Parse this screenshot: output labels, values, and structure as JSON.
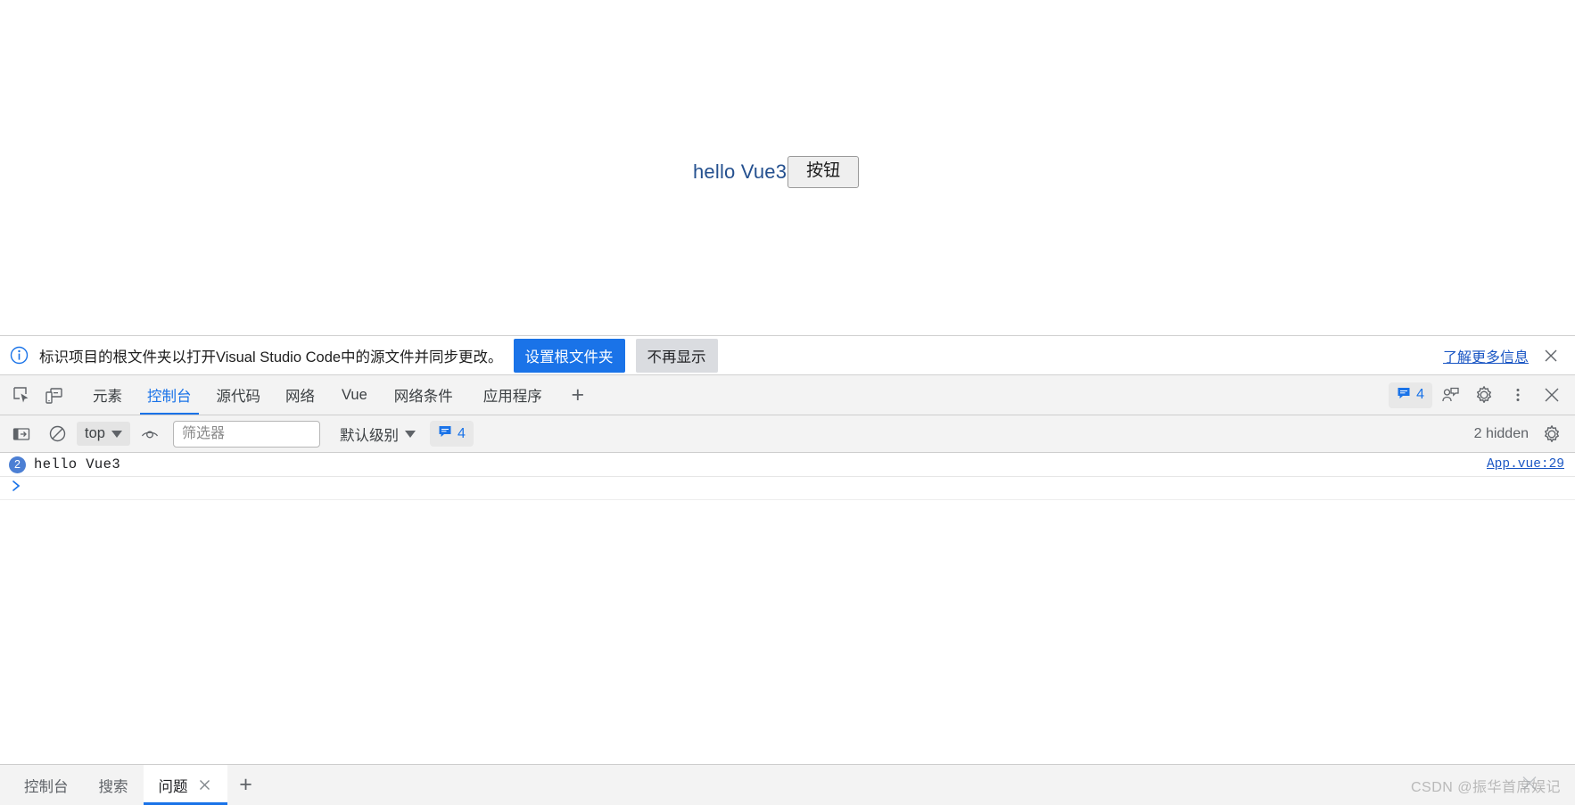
{
  "page": {
    "text": "hello Vue3",
    "button_label": "按钮"
  },
  "infobar": {
    "icon": "info-circle-icon",
    "message": "标识项目的根文件夹以打开Visual Studio Code中的源文件并同步更改。",
    "primary_button": "设置根文件夹",
    "secondary_button": "不再显示",
    "learn_more": "了解更多信息",
    "close_icon": "close-icon",
    "primary_color": "#1a73e8",
    "link_color": "#1a56c4"
  },
  "devtools_tabbar": {
    "left_icons": [
      {
        "name": "inspect-element-icon"
      },
      {
        "name": "device-toolbar-icon"
      }
    ],
    "tabs": [
      {
        "label": "元素",
        "active": false
      },
      {
        "label": "控制台",
        "active": true
      },
      {
        "label": "源代码",
        "active": false
      },
      {
        "label": "网络",
        "active": false
      },
      {
        "label": "Vue",
        "active": false
      },
      {
        "label": "网络条件",
        "active": false
      },
      {
        "label": "应用程序",
        "active": false
      }
    ],
    "add_tab_label": "+",
    "message_count": "4",
    "right_icons": [
      {
        "name": "feedback-icon"
      },
      {
        "name": "gear-icon"
      },
      {
        "name": "kebab-menu-icon"
      },
      {
        "name": "close-icon"
      }
    ],
    "active_color": "#1a73e8"
  },
  "console_toolbar": {
    "sidebar_toggle_icon": "console-sidebar-icon",
    "clear_icon": "clear-console-icon",
    "context": "top",
    "eye_icon": "live-expression-icon",
    "filter_placeholder": "筛选器",
    "filter_value": "",
    "level": "默认级别",
    "message_count": "4",
    "hidden_text": "2 hidden",
    "settings_icon": "gear-icon"
  },
  "console": {
    "messages": [
      {
        "count": "2",
        "text": "hello Vue3",
        "source": "App.vue:29"
      }
    ],
    "prompt": "❯"
  },
  "drawer": {
    "tabs": [
      {
        "label": "控制台",
        "active": false,
        "closable": false
      },
      {
        "label": "搜索",
        "active": false,
        "closable": false
      },
      {
        "label": "问题",
        "active": true,
        "closable": true
      }
    ],
    "add_tab_label": "+",
    "watermark": "CSDN @振华首席娱记"
  }
}
